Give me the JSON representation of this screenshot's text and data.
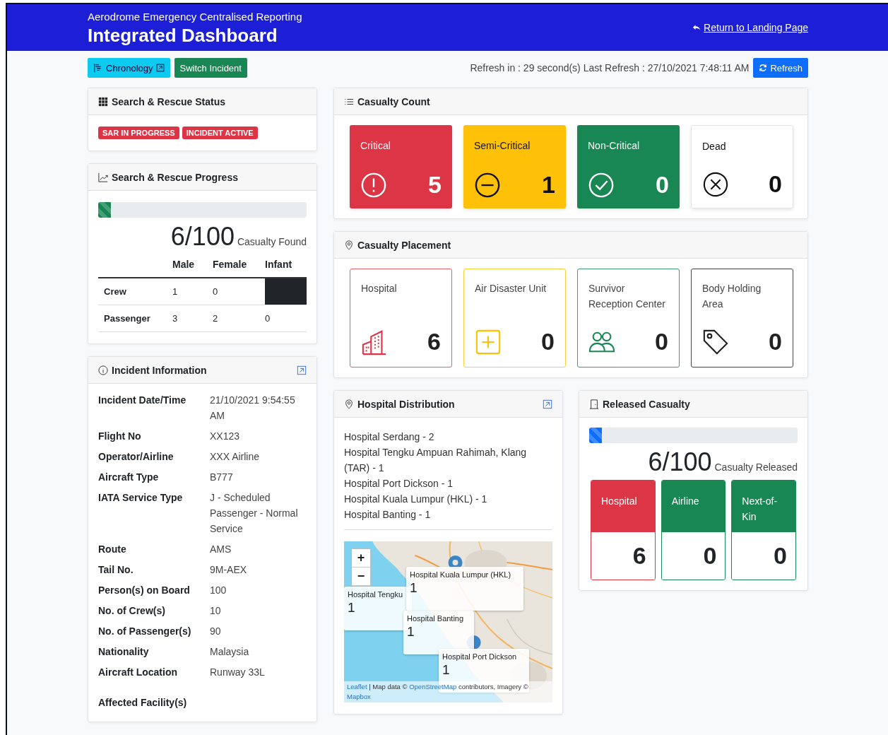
{
  "header": {
    "subtitle": "Aerodrome Emergency Centralised Reporting",
    "title": "Integrated Dashboard",
    "return_link": "Return to Landing Page"
  },
  "toolbar": {
    "buttons": [
      {
        "label": "Chronology",
        "kind": "info"
      },
      {
        "label": "Switch Incident",
        "kind": "success"
      }
    ],
    "refresh_text": "Refresh in : 29 second(s) Last Refresh : 27/10/2021 7:48:11 AM",
    "refresh_button": "Refresh"
  },
  "sar_status": {
    "title": "Search & Rescue Status",
    "badges": [
      "SAR IN PROGRESS",
      "INCIDENT ACTIVE"
    ]
  },
  "sar_progress": {
    "title": "Search & Rescue Progress",
    "level": 0.06,
    "count": "6/100",
    "caption": "Casualty Found",
    "columns": [
      "Male",
      "Female",
      "Infant"
    ],
    "rows": [
      {
        "label": "Crew",
        "male": "1",
        "female": "0",
        "infant_blocked": true
      },
      {
        "label": "Passenger",
        "male": "3",
        "female": "2",
        "infant": "0",
        "infant_blocked": false
      }
    ]
  },
  "incident": {
    "title": "Incident Information",
    "fields": [
      {
        "label": "Incident Date/Time",
        "value": "21/10/2021 9:54:55 AM"
      },
      {
        "label": "Flight No",
        "value": "XX123"
      },
      {
        "label": "Operator/Airline",
        "value": "XXX Airline"
      },
      {
        "label": "Aircraft Type",
        "value": "B777"
      },
      {
        "label": "IATA Service Type",
        "value": "J - Scheduled Passenger - Normal Service"
      },
      {
        "label": "Route",
        "value": "AMS"
      },
      {
        "label": "Tail No.",
        "value": "9M-AEX"
      },
      {
        "label": "Person(s) on Board",
        "value": "100"
      },
      {
        "label": "No. of Crew(s)",
        "value": "10"
      },
      {
        "label": "No. of Passenger(s)",
        "value": "90"
      },
      {
        "label": "Nationality",
        "value": "Malaysia"
      },
      {
        "label": "Aircraft Location",
        "value": "Runway 33L"
      },
      {
        "label": "Affected Facility(s)"
      }
    ]
  },
  "casualty_count": {
    "title": "Casualty Count",
    "cards": [
      {
        "label": "Critical",
        "count": "5",
        "kind": "critical"
      },
      {
        "label": "Semi-Critical",
        "count": "1",
        "kind": "semi"
      },
      {
        "label": "Non-Critical",
        "count": "0",
        "kind": "non"
      },
      {
        "label": "Dead",
        "count": "0",
        "kind": "dead"
      }
    ]
  },
  "placement": {
    "title": "Casualty Placement",
    "cards": [
      {
        "label": "Hospital",
        "count": "6",
        "kind": "hospital"
      },
      {
        "label": "Air Disaster Unit",
        "count": "0",
        "kind": "adu"
      },
      {
        "label": "Survivor Reception Center",
        "count": "0",
        "kind": "survivor"
      },
      {
        "label": "Body Holding Area",
        "count": "0",
        "kind": "body"
      }
    ]
  },
  "hospital_distribution": {
    "title": "Hospital Distribution",
    "items": [
      "Hospital Serdang - 2",
      "Hospital Tengku Ampuan Rahimah, Klang (TAR) - 1",
      "Hospital Port Dickson - 1",
      "Hospital Kuala Lumpur (HKL) - 1",
      "Hospital Banting - 1"
    ],
    "map": {
      "zoom_in": "+",
      "zoom_out": "−",
      "popups": [
        {
          "name": "Hospital Tengku",
          "count": "1"
        },
        {
          "name": "Hospital Kuala Lumpur (HKL)",
          "count": "1"
        },
        {
          "name": "Hospital Banting",
          "count": "1"
        },
        {
          "name": "Hospital Port Dickson",
          "count": "1"
        }
      ],
      "attribution": [
        {
          "text": "Leaflet",
          "link": true
        },
        {
          "text": "| Map data ©",
          "link": false
        },
        {
          "text": "OpenStreetMap",
          "link": true
        },
        {
          "text": "contributors, Imagery ©",
          "link": false
        },
        {
          "text": "Mapbox",
          "link": true
        }
      ]
    }
  },
  "released": {
    "title": "Released Casualty",
    "level": 0.06,
    "count": "6/100",
    "caption": "Casualty Released",
    "cards": [
      {
        "label": "Hospital",
        "count": "6",
        "kind": "hospital"
      },
      {
        "label": "Airline",
        "count": "0",
        "kind": "airline"
      },
      {
        "label": "Next-of-Kin",
        "count": "0",
        "kind": "nok"
      }
    ]
  }
}
